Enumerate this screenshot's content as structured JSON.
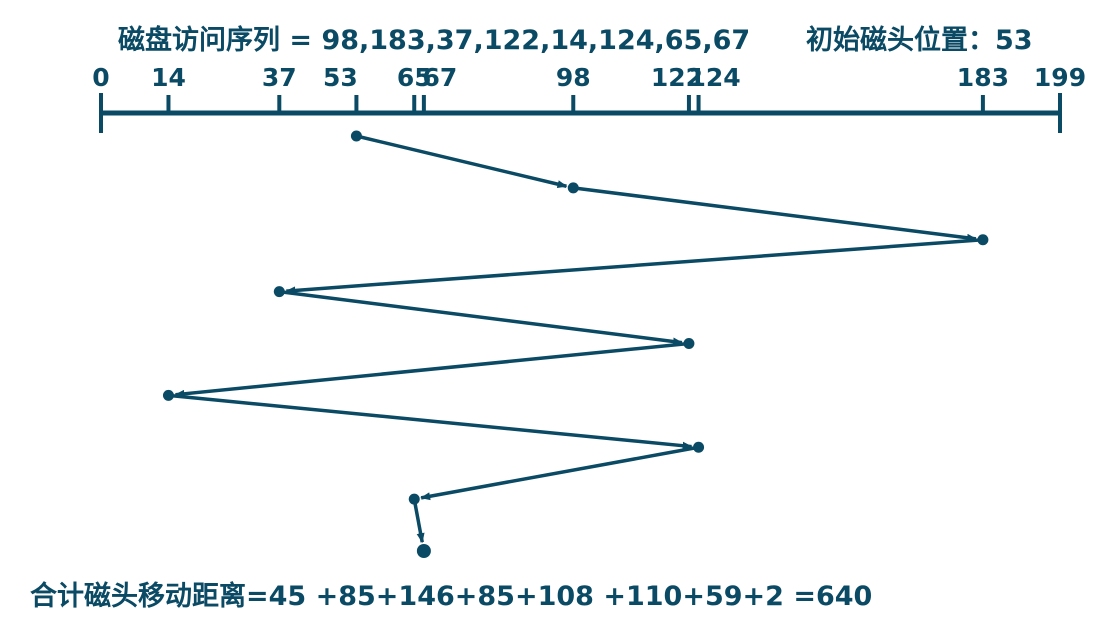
{
  "header": {
    "sequence_label": "磁盘访问序列",
    "sequence_values": "98,183,37,122,14,124,65,67",
    "start_label": "初始磁头位置：",
    "start_value": "53"
  },
  "footer": {
    "total_label": "合计磁头移动距离",
    "total_expression": "45 +85+146+85+108 +110+59+2",
    "total_value": "640"
  },
  "axis": {
    "min": 0,
    "max": 199,
    "ticks": [
      0,
      14,
      37,
      53,
      65,
      67,
      98,
      122,
      124,
      183,
      199
    ]
  },
  "path": [
    53,
    98,
    183,
    37,
    122,
    14,
    124,
    65,
    67
  ],
  "colors": {
    "primary": "#0b4a64"
  }
}
